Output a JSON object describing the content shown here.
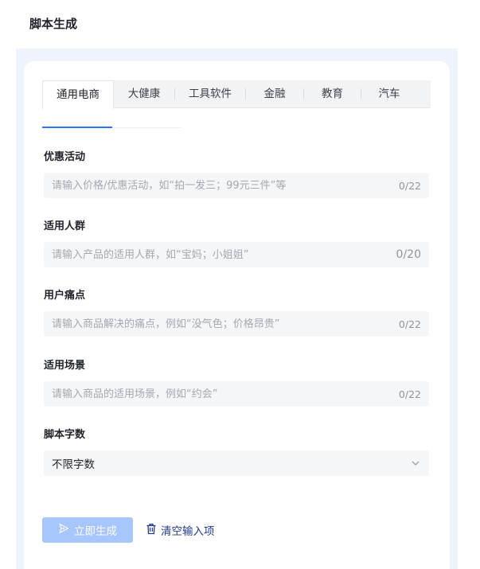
{
  "page": {
    "title": "脚本生成"
  },
  "tabs": [
    {
      "label": "通用电商",
      "active": true
    },
    {
      "label": "大健康"
    },
    {
      "label": "工具软件"
    },
    {
      "label": "金融"
    },
    {
      "label": "教育"
    },
    {
      "label": "汽车"
    }
  ],
  "fields": {
    "promotion": {
      "label": "优惠活动",
      "placeholder": "请输入价格/优惠活动，如“拍一发三；99元三件”等",
      "value": "",
      "counter": "0/22"
    },
    "audience": {
      "label": "适用人群",
      "placeholder": "请输入产品的适用人群，如“宝妈；小姐姐”",
      "value": "",
      "counter": "0/20"
    },
    "pain_points": {
      "label": "用户痛点",
      "placeholder": "请输入商品解决的痛点，例如“没气色；价格昂贵”",
      "value": "",
      "counter": "0/22"
    },
    "scenario": {
      "label": "适用场景",
      "placeholder": "请输入商品的适用场景，例如“约会”",
      "value": "",
      "counter": "0/22"
    }
  },
  "word_count": {
    "label": "脚本字数",
    "selected": "不限字数"
  },
  "actions": {
    "generate_label": "立即生成",
    "clear_label": "清空输入项"
  },
  "colors": {
    "accent": "#3370ff",
    "button_disabled": "#a7c5ff",
    "panel_bg": "#eef3fc"
  },
  "icons": {
    "generate": "send-icon",
    "clear": "trash-icon",
    "dropdown": "chevron-down-icon"
  }
}
